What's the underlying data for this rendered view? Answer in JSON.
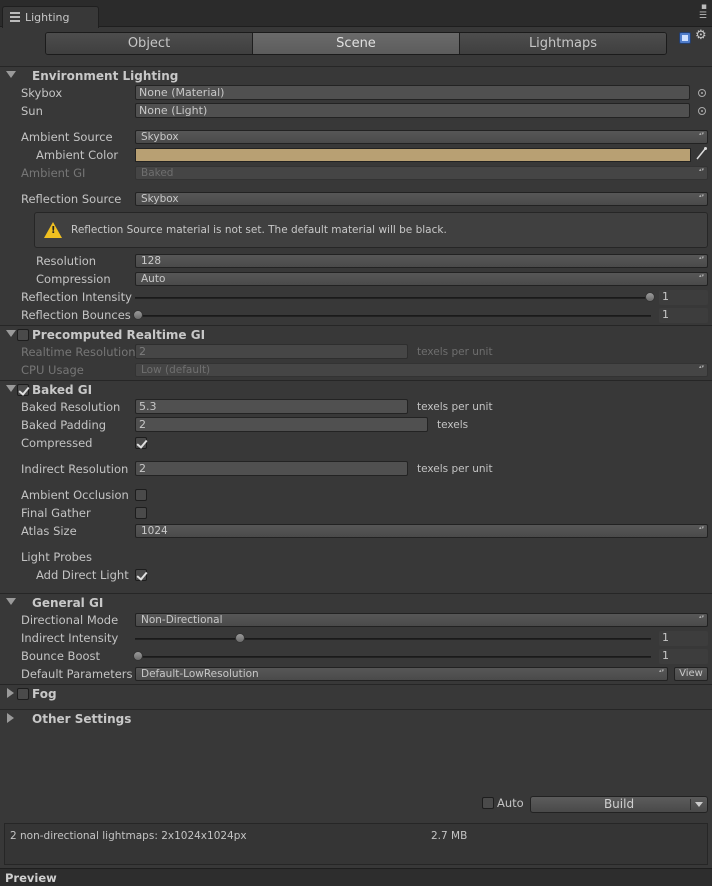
{
  "window": {
    "tab_title": "Lighting"
  },
  "toolbar": {
    "tabs": [
      "Object",
      "Scene",
      "Lightmaps"
    ],
    "active": "Scene"
  },
  "environment": {
    "title": "Environment Lighting",
    "skybox_label": "Skybox",
    "skybox_value": "None (Material)",
    "sun_label": "Sun",
    "sun_value": "None (Light)",
    "ambient_source_label": "Ambient Source",
    "ambient_source_value": "Skybox",
    "ambient_color_label": "Ambient Color",
    "ambient_color_hex": "#b8a073",
    "ambient_gi_label": "Ambient GI",
    "ambient_gi_value": "Baked",
    "reflection_source_label": "Reflection Source",
    "reflection_source_value": "Skybox",
    "warning": "Reflection Source material is not set. The default material will be black.",
    "resolution_label": "Resolution",
    "resolution_value": "128",
    "compression_label": "Compression",
    "compression_value": "Auto",
    "reflection_intensity_label": "Reflection Intensity",
    "reflection_intensity_value": "1",
    "reflection_bounces_label": "Reflection Bounces",
    "reflection_bounces_value": "1"
  },
  "realtime_gi": {
    "title": "Precomputed Realtime GI",
    "realtime_resolution_label": "Realtime Resolution",
    "realtime_resolution_value": "2",
    "unit": "texels per unit",
    "cpu_usage_label": "CPU Usage",
    "cpu_usage_value": "Low (default)"
  },
  "baked_gi": {
    "title": "Baked GI",
    "baked_resolution_label": "Baked Resolution",
    "baked_resolution_value": "5.3",
    "unit_per_unit": "texels per unit",
    "baked_padding_label": "Baked Padding",
    "baked_padding_value": "2",
    "unit_texels": "texels",
    "compressed_label": "Compressed",
    "indirect_resolution_label": "Indirect Resolution",
    "indirect_resolution_value": "2",
    "ambient_occlusion_label": "Ambient Occlusion",
    "final_gather_label": "Final Gather",
    "atlas_size_label": "Atlas Size",
    "atlas_size_value": "1024",
    "light_probes_label": "Light Probes",
    "add_direct_light_label": "Add Direct Light"
  },
  "general_gi": {
    "title": "General GI",
    "directional_mode_label": "Directional Mode",
    "directional_mode_value": "Non-Directional",
    "indirect_intensity_label": "Indirect Intensity",
    "indirect_intensity_value": "1",
    "bounce_boost_label": "Bounce Boost",
    "bounce_boost_value": "1",
    "default_parameters_label": "Default Parameters",
    "default_parameters_value": "Default-LowResolution",
    "view_label": "View"
  },
  "fog": {
    "title": "Fog"
  },
  "other": {
    "title": "Other Settings"
  },
  "build": {
    "auto_label": "Auto",
    "build_label": "Build"
  },
  "status": {
    "lightmaps": "2 non-directional lightmaps: 2x1024x1024px",
    "size": "2.7 MB"
  },
  "preview": {
    "label": "Preview"
  }
}
